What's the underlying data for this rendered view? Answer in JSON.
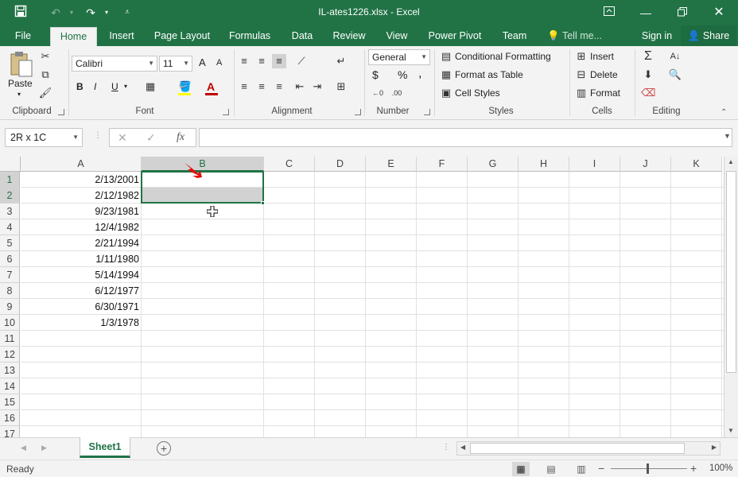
{
  "window": {
    "title": "IL-ates1226.xlsx - Excel",
    "ribbon_display_icon": "ribbon-display-icon",
    "minimize_icon": "minimize-icon",
    "restore_icon": "restore-icon",
    "close_icon": "close-icon"
  },
  "quick_access": [
    "save-icon",
    "undo-icon",
    "redo-icon",
    "customize-qat-icon"
  ],
  "tabs": [
    {
      "label": "File"
    },
    {
      "label": "Home"
    },
    {
      "label": "Insert"
    },
    {
      "label": "Page Layout"
    },
    {
      "label": "Formulas"
    },
    {
      "label": "Data"
    },
    {
      "label": "Review"
    },
    {
      "label": "View"
    },
    {
      "label": "Power Pivot"
    },
    {
      "label": "Team"
    },
    {
      "label": "Tell me..."
    }
  ],
  "account": {
    "signin": "Sign in",
    "share": "Share"
  },
  "ribbon": {
    "clipboard": {
      "label": "Clipboard",
      "paste": "Paste"
    },
    "font": {
      "label": "Font",
      "font_name": "Calibri",
      "font_size": "11",
      "bold": "B",
      "italic": "I",
      "underline": "U",
      "grow": "A",
      "shrink": "A",
      "font_color": "A"
    },
    "alignment": {
      "label": "Alignment"
    },
    "number": {
      "label": "Number",
      "format": "General",
      "currency": "$",
      "percent": "%",
      "comma": ","
    },
    "styles": {
      "label": "Styles",
      "conditional": "Conditional Formatting",
      "format_table": "Format as Table",
      "cell_styles": "Cell Styles"
    },
    "cells": {
      "label": "Cells",
      "insert": "Insert",
      "delete": "Delete",
      "format": "Format"
    },
    "editing": {
      "label": "Editing"
    }
  },
  "formula_bar": {
    "namebox": "2R x 1C",
    "fx": "fx",
    "value": ""
  },
  "columns": [
    "A",
    "B",
    "C",
    "D",
    "E",
    "F",
    "G",
    "H",
    "I",
    "J",
    "K"
  ],
  "selected_column": "B",
  "rows": [
    "1",
    "2",
    "3",
    "4",
    "5",
    "6",
    "7",
    "8",
    "9",
    "10",
    "11",
    "12",
    "13",
    "14",
    "15",
    "16",
    "17"
  ],
  "selected_rows": [
    "1",
    "2"
  ],
  "cells_a": [
    "2/13/2001",
    "2/12/1982",
    "9/23/1981",
    "12/4/1982",
    "2/21/1994",
    "1/11/1980",
    "5/14/1994",
    "6/12/1977",
    "6/30/1971",
    "1/3/1978"
  ],
  "sheets": [
    {
      "label": "Sheet1",
      "active": true
    }
  ],
  "status": {
    "text": "Ready",
    "zoom": "100%"
  },
  "colors": {
    "accent": "#217346",
    "selection_fill": "#d2d2d2"
  }
}
